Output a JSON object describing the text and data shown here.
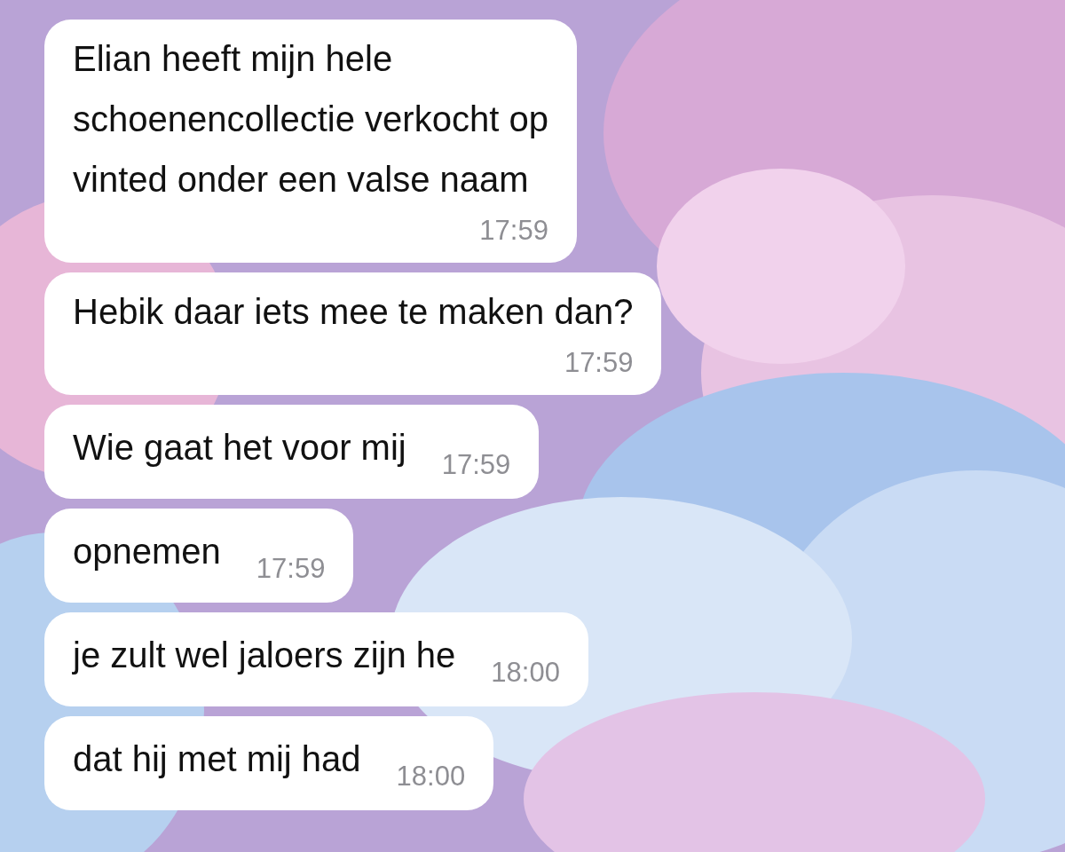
{
  "messages": [
    {
      "kind": "stacked",
      "text": "Elian heeft mijn hele\nschoenencollectie verkocht op\nvinted onder een valse naam",
      "time": "17:59"
    },
    {
      "kind": "stacked",
      "text": "Hebik daar iets mee te maken dan?",
      "time": "17:59"
    },
    {
      "kind": "inline",
      "text": "Wie gaat het voor mij",
      "time": "17:59"
    },
    {
      "kind": "inline",
      "text": "opnemen",
      "time": "17:59"
    },
    {
      "kind": "inline",
      "text": "je zult wel jaloers zijn he",
      "time": "18:00"
    },
    {
      "kind": "inline",
      "text": "dat hij met mij had",
      "time": "18:00"
    }
  ]
}
